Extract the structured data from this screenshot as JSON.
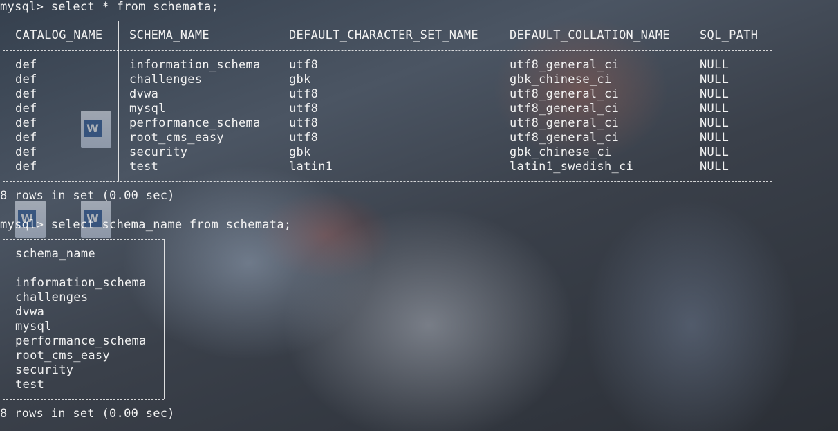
{
  "session": {
    "prompt": "mysql>",
    "query1": "select * from schemata;",
    "query2": "select schema_name from schemata;"
  },
  "table1": {
    "columns": [
      "CATALOG_NAME",
      "SCHEMA_NAME",
      "DEFAULT_CHARACTER_SET_NAME",
      "DEFAULT_COLLATION_NAME",
      "SQL_PATH"
    ],
    "rows": [
      [
        "def",
        "information_schema",
        "utf8",
        "utf8_general_ci",
        "NULL"
      ],
      [
        "def",
        "challenges",
        "gbk",
        "gbk_chinese_ci",
        "NULL"
      ],
      [
        "def",
        "dvwa",
        "utf8",
        "utf8_general_ci",
        "NULL"
      ],
      [
        "def",
        "mysql",
        "utf8",
        "utf8_general_ci",
        "NULL"
      ],
      [
        "def",
        "performance_schema",
        "utf8",
        "utf8_general_ci",
        "NULL"
      ],
      [
        "def",
        "root_cms_easy",
        "utf8",
        "utf8_general_ci",
        "NULL"
      ],
      [
        "def",
        "security",
        "gbk",
        "gbk_chinese_ci",
        "NULL"
      ],
      [
        "def",
        "test",
        "latin1",
        "latin1_swedish_ci",
        "NULL"
      ]
    ],
    "summary": "8 rows in set (0.00 sec)"
  },
  "table2": {
    "columns": [
      "schema_name"
    ],
    "rows": [
      [
        "information_schema"
      ],
      [
        "challenges"
      ],
      [
        "dvwa"
      ],
      [
        "mysql"
      ],
      [
        "performance_schema"
      ],
      [
        "root_cms_easy"
      ],
      [
        "security"
      ],
      [
        "test"
      ]
    ],
    "summary": "8 rows in set (0.00 sec)"
  }
}
